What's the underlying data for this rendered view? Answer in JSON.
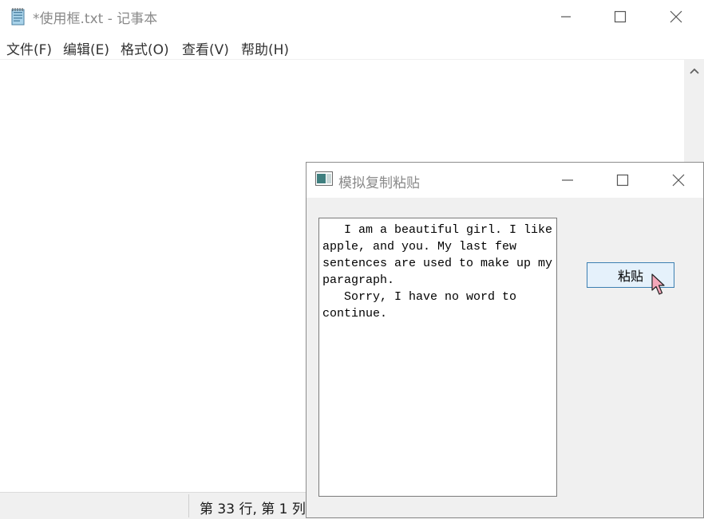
{
  "notepad": {
    "title": "*使用框.txt - 记事本",
    "menu": [
      "文件(F)",
      "编辑(E)",
      "格式(O)",
      "查看(V)",
      "帮助(H)"
    ],
    "status_text": "第 33 行, 第 1 列",
    "icons": {
      "app": "notepad-icon",
      "minimize": "minimize-icon",
      "maximize": "maximize-icon",
      "close": "close-icon",
      "scroll_up": "scroll-up-arrow-icon"
    }
  },
  "dialog": {
    "title": "模拟复制粘贴",
    "text_content": "   I am a beautiful girl. I like apple, and you. My last few sentences are used to make up my paragraph.\n   Sorry, I have no word to continue.",
    "paste_label": "粘贴",
    "icons": {
      "app": "window-app-icon",
      "minimize": "minimize-icon",
      "maximize": "maximize-icon",
      "close": "close-icon",
      "cursor": "mouse-pointer-icon"
    }
  },
  "colors": {
    "title_text": "#8a8a8a",
    "button_hover_fill": "#e5f1fb",
    "button_hover_border": "#3c7fb1",
    "cursor_fill": "#f4a7b9",
    "statusbar_bg": "#f0f0f0"
  }
}
